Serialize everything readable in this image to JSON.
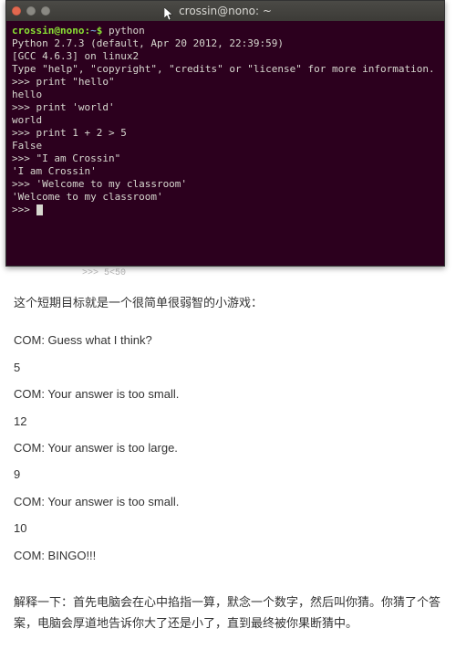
{
  "window": {
    "title": "crossin@nono: ~"
  },
  "prompt": {
    "userhost": "crossin@nono",
    "path": "~",
    "cmd": "python"
  },
  "python_header": {
    "l1": "Python 2.7.3 (default, Apr 20 2012, 22:39:59)",
    "l2": "[GCC 4.6.3] on linux2",
    "l3": "Type \"help\", \"copyright\", \"credits\" or \"license\" for more information."
  },
  "repl": {
    "p1": ">>> print \"hello\"",
    "o1": "hello",
    "p2": ">>> print 'world'",
    "o2": "world",
    "p3": ">>> print 1 + 2 > 5",
    "o3": "False",
    "p4": ">>> \"I am Crossin\"",
    "o4": "'I am Crossin'",
    "p5": ">>> 'Welcome to my classroom'",
    "o5": "'Welcome to my classroom'",
    "p6": ">>> "
  },
  "below_term": ">>> 5<50",
  "article": {
    "intro": "这个短期目标就是一个很简单很弱智的小游戏：",
    "g1": "COM: Guess what I think?",
    "n1": "5",
    "g2": "COM: Your answer is too small.",
    "n2": "12",
    "g3": "COM: Your answer is too large.",
    "n3": "9",
    "g4": "COM: Your answer is too small.",
    "n4": "10",
    "g5": "COM: BINGO!!!",
    "explain": "解释一下：首先电脑会在心中掐指一算，默念一个数字，然后叫你猜。你猜了个答案，电脑会厚道地告诉你大了还是小了，直到最终被你果断猜中。"
  }
}
